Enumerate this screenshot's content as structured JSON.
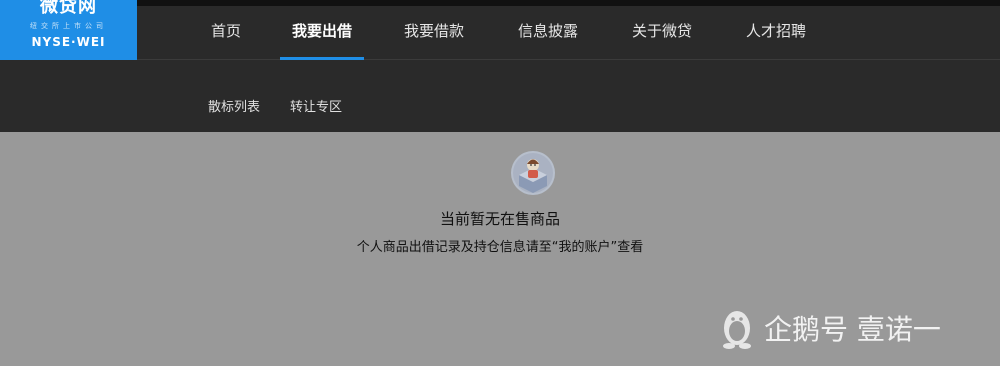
{
  "logo": {
    "name": "微贷网",
    "subtitle": "纽交所上市公司",
    "english": "NYSE·WEI"
  },
  "nav": {
    "items": [
      {
        "label": "首页"
      },
      {
        "label": "我要出借",
        "active": true
      },
      {
        "label": "我要借款"
      },
      {
        "label": "信息披露"
      },
      {
        "label": "关于微贷"
      },
      {
        "label": "人才招聘"
      }
    ]
  },
  "subnav": {
    "items": [
      {
        "label": "散标列表"
      },
      {
        "label": "转让专区"
      }
    ]
  },
  "empty_state": {
    "title": "当前暂无在售商品",
    "description": "个人商品出借记录及持仓信息请至“我的账户”查看"
  },
  "watermark": {
    "text": "企鹅号 壹诺一"
  },
  "colors": {
    "accent": "#1f8ee6",
    "nav_bg": "#2a2a2a",
    "content_bg": "#999999"
  }
}
